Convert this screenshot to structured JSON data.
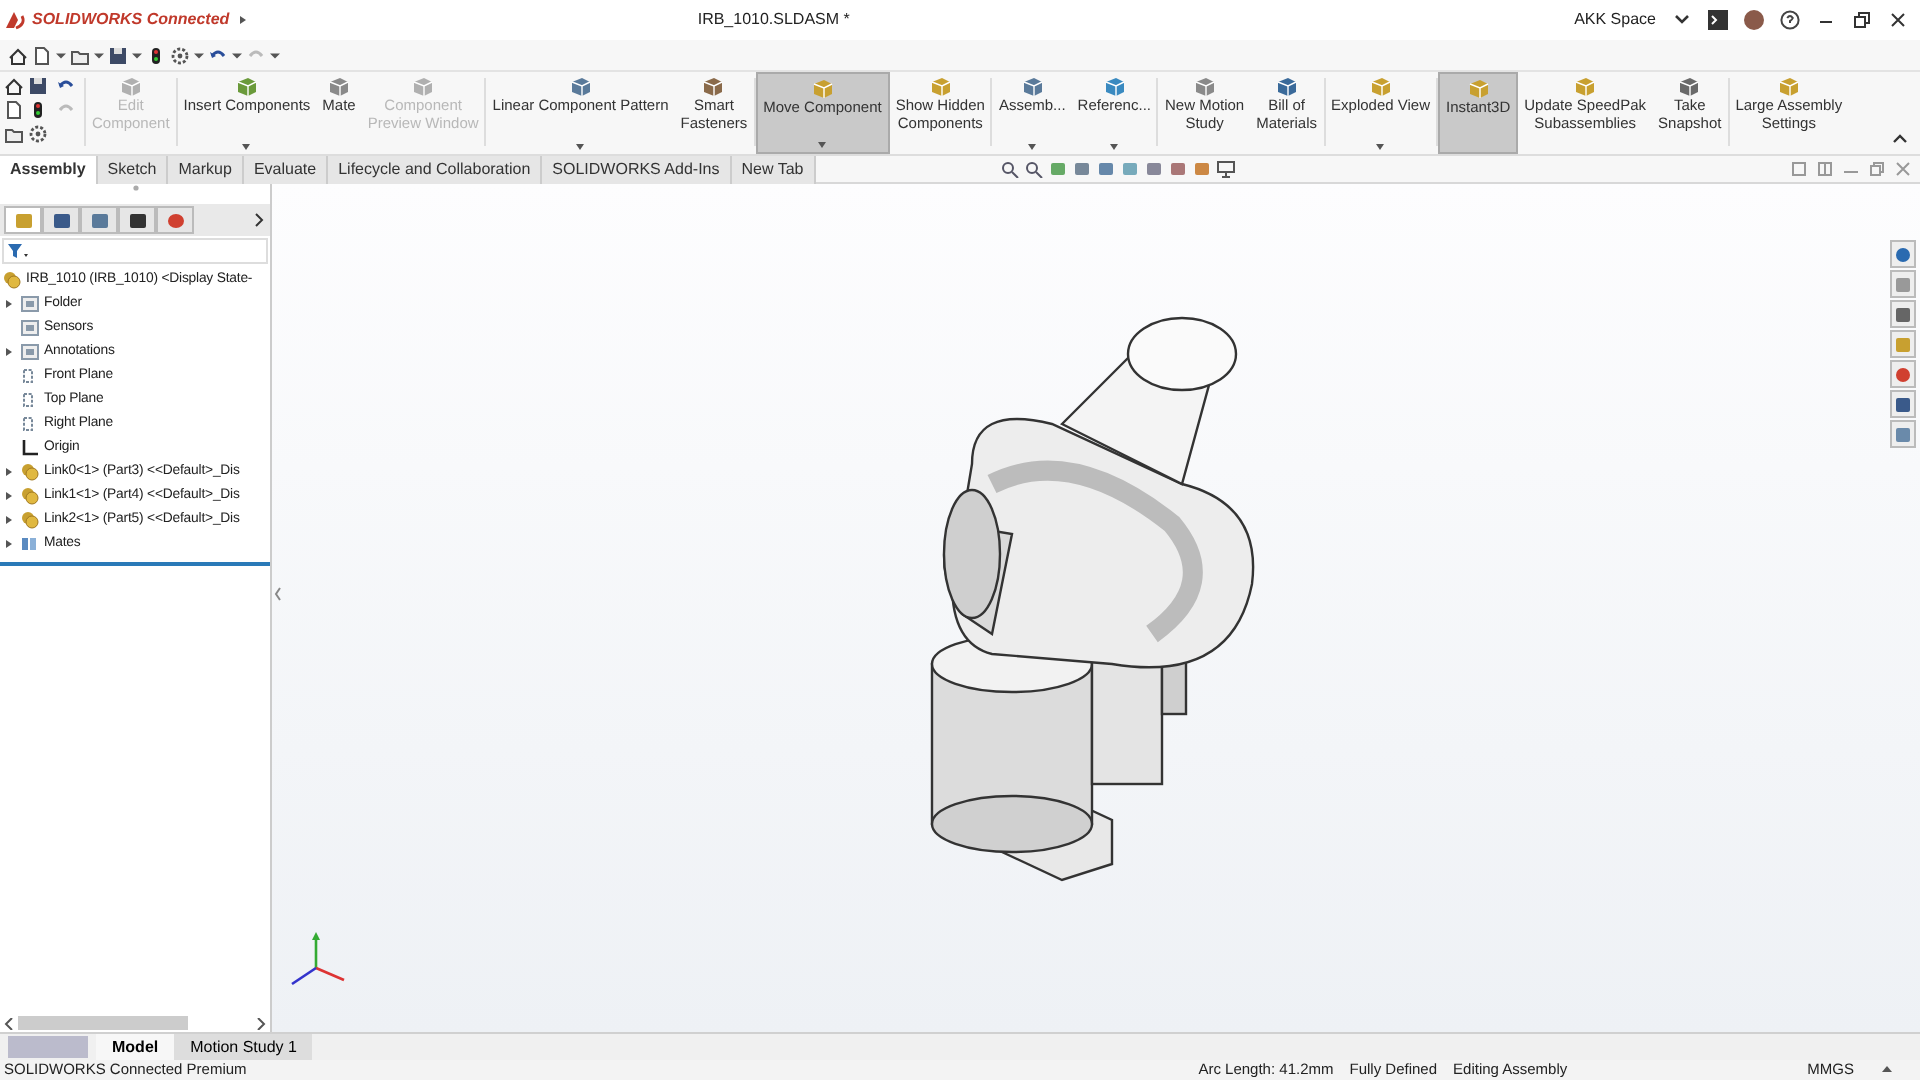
{
  "app": {
    "brand": "SOLIDWORKS Connected",
    "title": "IRB_1010.SLDASM *",
    "workspace": "AKK Space"
  },
  "ribbon": [
    {
      "lines": [
        "Edit",
        "Component"
      ],
      "disabled": true,
      "selected": false,
      "dropdown": false,
      "color": "#b0b0b0"
    },
    {
      "lines": [
        "Insert Components"
      ],
      "disabled": false,
      "selected": false,
      "dropdown": true,
      "color": "#6a9a3a"
    },
    {
      "lines": [
        "Mate"
      ],
      "disabled": false,
      "selected": false,
      "dropdown": false,
      "color": "#8a8a8a"
    },
    {
      "lines": [
        "Component",
        "Preview Window"
      ],
      "disabled": true,
      "selected": false,
      "dropdown": false,
      "color": "#b0b0b0"
    },
    {
      "lines": [
        "Linear Component Pattern"
      ],
      "disabled": false,
      "selected": false,
      "dropdown": true,
      "color": "#5a7a9a"
    },
    {
      "lines": [
        "Smart",
        "Fasteners"
      ],
      "disabled": false,
      "selected": false,
      "dropdown": false,
      "color": "#8a6a4a"
    },
    {
      "lines": [
        "Move Component"
      ],
      "disabled": false,
      "selected": true,
      "dropdown": true,
      "color": "#c8a030"
    },
    {
      "lines": [
        "Show Hidden",
        "Components"
      ],
      "disabled": false,
      "selected": false,
      "dropdown": false,
      "color": "#c8a030"
    },
    {
      "lines": [
        "Assemb..."
      ],
      "disabled": false,
      "selected": false,
      "dropdown": true,
      "color": "#5a7a9a"
    },
    {
      "lines": [
        "Referenc..."
      ],
      "disabled": false,
      "selected": false,
      "dropdown": true,
      "color": "#3a8ac0"
    },
    {
      "lines": [
        "New Motion",
        "Study"
      ],
      "disabled": false,
      "selected": false,
      "dropdown": false,
      "color": "#8a8a8a"
    },
    {
      "lines": [
        "Bill of",
        "Materials"
      ],
      "disabled": false,
      "selected": false,
      "dropdown": false,
      "color": "#3a6a9a"
    },
    {
      "lines": [
        "Exploded View"
      ],
      "disabled": false,
      "selected": false,
      "dropdown": true,
      "color": "#c8a030"
    },
    {
      "lines": [
        "Instant3D"
      ],
      "disabled": false,
      "selected": true,
      "dropdown": false,
      "color": "#c8a030"
    },
    {
      "lines": [
        "Update SpeedPak",
        "Subassemblies"
      ],
      "disabled": false,
      "selected": false,
      "dropdown": false,
      "color": "#c8a030"
    },
    {
      "lines": [
        "Take",
        "Snapshot"
      ],
      "disabled": false,
      "selected": false,
      "dropdown": false,
      "color": "#6a6a6a"
    },
    {
      "lines": [
        "Large Assembly",
        "Settings"
      ],
      "disabled": false,
      "selected": false,
      "dropdown": false,
      "color": "#c8a030"
    }
  ],
  "tabs": [
    {
      "label": "Assembly",
      "selected": true
    },
    {
      "label": "Sketch",
      "selected": false
    },
    {
      "label": "Markup",
      "selected": false
    },
    {
      "label": "Evaluate",
      "selected": false
    },
    {
      "label": "Lifecycle and Collaboration",
      "selected": false
    },
    {
      "label": "SOLIDWORKS Add-Ins",
      "selected": false
    },
    {
      "label": "New Tab",
      "selected": false
    }
  ],
  "tree": {
    "label": "IRB_1010 (IRB_1010) <Display State-",
    "kind": "assembly",
    "children": [
      {
        "label": "Folder",
        "kind": "folder",
        "expanded": false
      },
      {
        "label": "Sensors",
        "kind": "sensor"
      },
      {
        "label": "Annotations",
        "kind": "annotation",
        "expanded": false
      },
      {
        "label": "Front Plane",
        "kind": "plane"
      },
      {
        "label": "Top Plane",
        "kind": "plane"
      },
      {
        "label": "Right Plane",
        "kind": "plane"
      },
      {
        "label": "Origin",
        "kind": "origin"
      },
      {
        "label": "Link0<1> (Part3) <<Default>_Dis",
        "kind": "part",
        "expanded": false
      },
      {
        "label": "Link1<1> (Part4) <<Default>_Dis",
        "kind": "part",
        "expanded": false
      },
      {
        "label": "Link2<1> (Part5) <<Default>_Dis",
        "kind": "part",
        "expanded": false
      },
      {
        "label": "Mates",
        "kind": "mates",
        "expanded": false
      }
    ]
  },
  "bottom_tabs": [
    {
      "label": "Model",
      "selected": true
    },
    {
      "label": "Motion Study 1",
      "selected": false
    }
  ],
  "status_bar": {
    "product": "SOLIDWORKS Connected Premium",
    "items": [
      "Arc Length: 41.2mm",
      "Fully Defined",
      "Editing Assembly"
    ],
    "units": "MMGS"
  }
}
